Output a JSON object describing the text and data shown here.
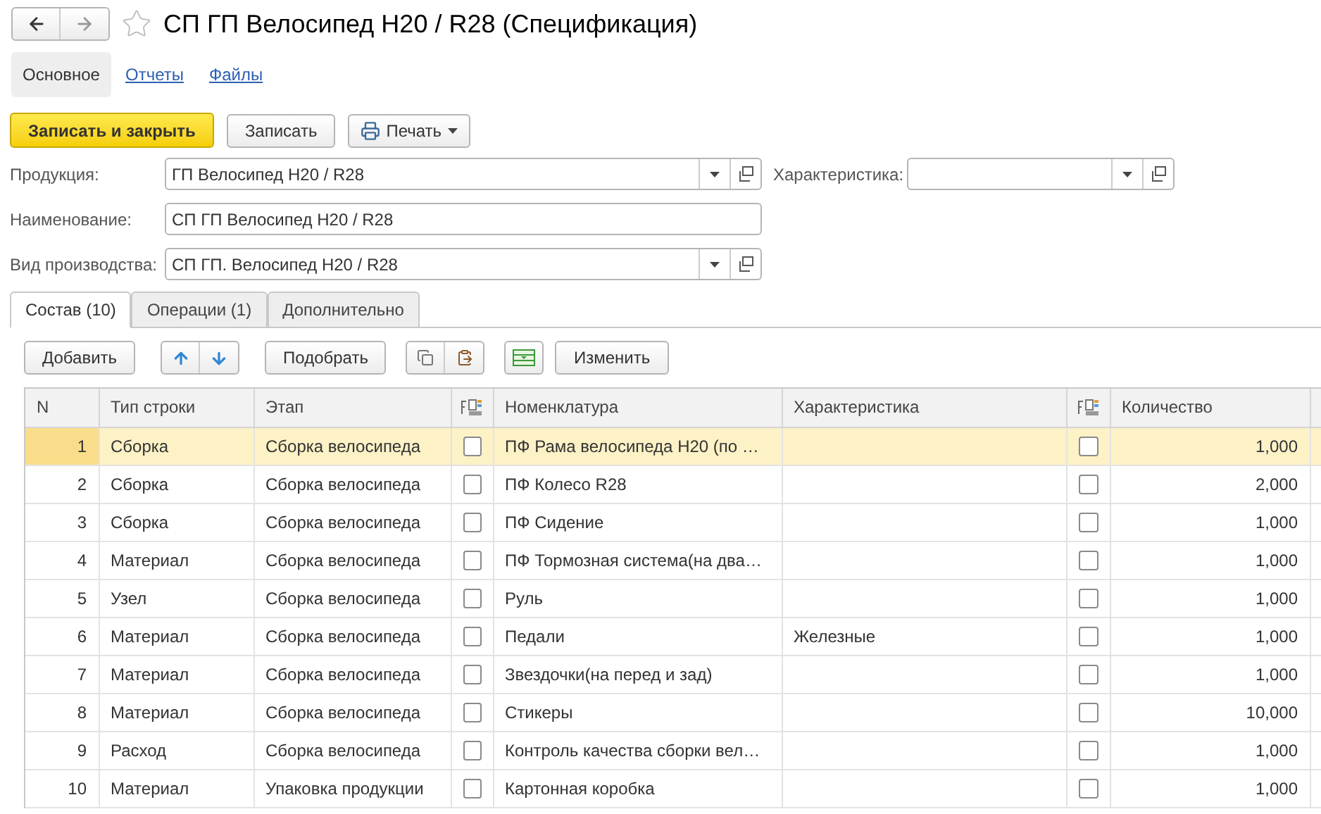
{
  "window": {
    "title": "СП ГП Велосипед H20 / R28 (Спецификация)"
  },
  "nav_tabs": [
    {
      "label": "Основное",
      "selected": true
    },
    {
      "label": "Отчеты",
      "selected": false
    },
    {
      "label": "Файлы",
      "selected": false
    }
  ],
  "toolbar": {
    "save_close": "Записать и закрыть",
    "save": "Записать",
    "print": "Печать"
  },
  "fields": {
    "product": {
      "label": "Продукция:",
      "value": "ГП Велосипед H20 / R28"
    },
    "characteristic": {
      "label": "Характеристика:"
    },
    "name": {
      "label": "Наименование:",
      "value": "СП ГП Велосипед H20 / R28"
    },
    "production_kind": {
      "label": "Вид производства:",
      "value": "СП ГП. Велосипед H20 / R28"
    }
  },
  "tabs": [
    {
      "label": "Состав (10)",
      "selected": true
    },
    {
      "label": "Операции (1)",
      "selected": false
    },
    {
      "label": "Дополнительно",
      "selected": false
    }
  ],
  "table_toolbar": {
    "add": "Добавить",
    "pick": "Подобрать",
    "change": "Изменить"
  },
  "table": {
    "columns": [
      "N",
      "Тип строки",
      "Этап",
      "Номенклатура",
      "Характеристика",
      "Количество"
    ],
    "rows": [
      {
        "n": "1",
        "type": "Сборка",
        "stage": "Сборка велосипеда",
        "flag_1": false,
        "item": "ПФ Рама велосипеда H20 (по …",
        "characteristic": "",
        "flag_2": false,
        "quantity": "1,000",
        "selected": true
      },
      {
        "n": "2",
        "type": "Сборка",
        "stage": "Сборка велосипеда",
        "flag_1": false,
        "item": "ПФ Колесо R28",
        "characteristic": "",
        "flag_2": false,
        "quantity": "2,000",
        "selected": false
      },
      {
        "n": "3",
        "type": "Сборка",
        "stage": "Сборка велосипеда",
        "flag_1": false,
        "item": "ПФ Сидение",
        "characteristic": "",
        "flag_2": false,
        "quantity": "1,000",
        "selected": false
      },
      {
        "n": "4",
        "type": "Материал",
        "stage": "Сборка велосипеда",
        "flag_1": false,
        "item": "ПФ Тормозная система(на два…",
        "characteristic": "",
        "flag_2": false,
        "quantity": "1,000",
        "selected": false
      },
      {
        "n": "5",
        "type": "Узел",
        "stage": "Сборка велосипеда",
        "flag_1": false,
        "item": "Руль",
        "characteristic": "",
        "flag_2": false,
        "quantity": "1,000",
        "selected": false
      },
      {
        "n": "6",
        "type": "Материал",
        "stage": "Сборка велосипеда",
        "flag_1": false,
        "item": "Педали",
        "characteristic": "Железные",
        "flag_2": false,
        "quantity": "1,000",
        "selected": false
      },
      {
        "n": "7",
        "type": "Материал",
        "stage": "Сборка велосипеда",
        "flag_1": false,
        "item": "Звездочки(на перед и зад)",
        "characteristic": "",
        "flag_2": false,
        "quantity": "1,000",
        "selected": false
      },
      {
        "n": "8",
        "type": "Материал",
        "stage": "Сборка велосипеда",
        "flag_1": false,
        "item": "Стикеры",
        "characteristic": "",
        "flag_2": false,
        "quantity": "10,000",
        "selected": false
      },
      {
        "n": "9",
        "type": "Расход",
        "stage": "Сборка велосипеда",
        "flag_1": false,
        "item": "Контроль качества сборки вел…",
        "characteristic": "",
        "flag_2": false,
        "quantity": "1,000",
        "selected": false
      },
      {
        "n": "10",
        "type": "Материал",
        "stage": "Упаковка продукции",
        "flag_1": false,
        "item": "Картонная коробка",
        "characteristic": "",
        "flag_2": false,
        "quantity": "1,000",
        "selected": false
      }
    ]
  }
}
